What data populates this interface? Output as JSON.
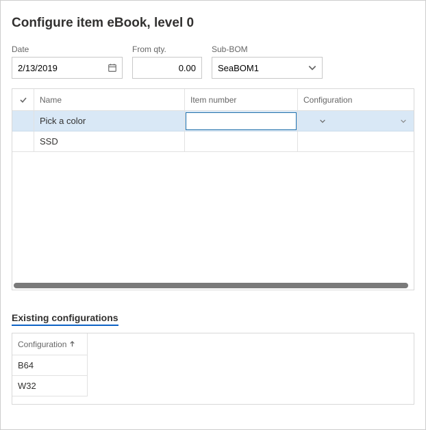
{
  "title": "Configure item eBook, level 0",
  "fields": {
    "date": {
      "label": "Date",
      "value": "2/13/2019"
    },
    "fromQty": {
      "label": "From qty.",
      "value": "0.00"
    },
    "subBom": {
      "label": "Sub-BOM",
      "value": "SeaBOM1"
    }
  },
  "grid": {
    "headers": {
      "check": "",
      "name": "Name",
      "item": "Item number",
      "conf": "Configuration"
    },
    "rows": [
      {
        "name": "Pick a color",
        "item": "",
        "conf": "",
        "selected": true,
        "editingItem": true
      },
      {
        "name": "SSD",
        "item": "",
        "conf": "",
        "selected": false,
        "editingItem": false
      }
    ]
  },
  "existing": {
    "title": "Existing configurations",
    "header": "Configuration",
    "rows": [
      "B64",
      "W32"
    ]
  }
}
